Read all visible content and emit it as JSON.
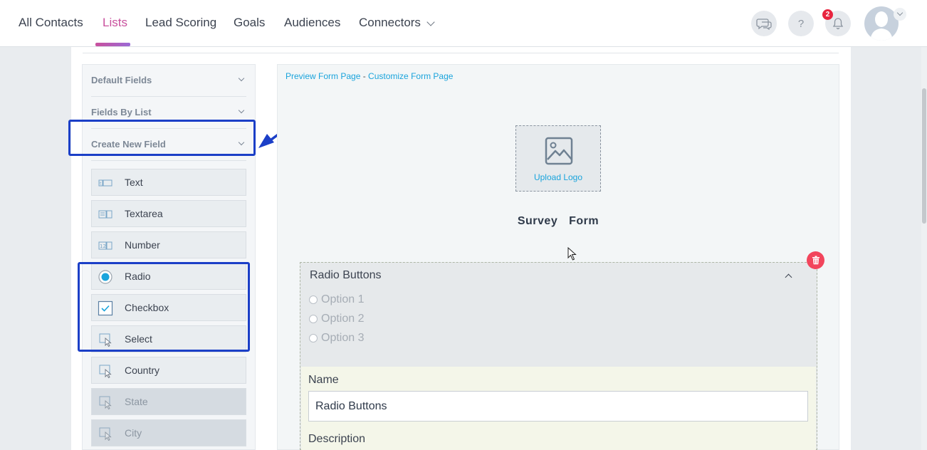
{
  "nav": {
    "items": [
      {
        "label": "All Contacts"
      },
      {
        "label": "Lists"
      },
      {
        "label": "Lead Scoring"
      },
      {
        "label": "Goals"
      },
      {
        "label": "Audiences"
      },
      {
        "label": "Connectors"
      }
    ],
    "active_item": "Lists",
    "notification_count": "2",
    "help_label": "?",
    "accent_color": "#c9509d"
  },
  "sidebar": {
    "sections": [
      {
        "label": "Default Fields",
        "icon": "chevron-down-icon"
      },
      {
        "label": "Fields By List",
        "icon": "chevron-down-icon"
      },
      {
        "label": "Create New Field",
        "icon": "chevron-down-icon"
      }
    ],
    "field_types": [
      {
        "label": "Text",
        "icon": "text-field-icon",
        "enabled": true
      },
      {
        "label": "Textarea",
        "icon": "textarea-field-icon",
        "enabled": true
      },
      {
        "label": "Number",
        "icon": "number-field-icon",
        "enabled": true
      },
      {
        "label": "Radio",
        "icon": "radio-field-icon",
        "enabled": true
      },
      {
        "label": "Checkbox",
        "icon": "checkbox-field-icon",
        "enabled": true
      },
      {
        "label": "Select",
        "icon": "select-field-icon",
        "enabled": true
      },
      {
        "label": "Country",
        "icon": "select-field-icon",
        "enabled": true
      },
      {
        "label": "State",
        "icon": "select-field-icon",
        "enabled": false
      },
      {
        "label": "City",
        "icon": "select-field-icon",
        "enabled": false
      }
    ]
  },
  "form": {
    "preview_link": "Preview Form Page",
    "separator": " - ",
    "customize_link": "Customize Form Page",
    "upload_logo": "Upload Logo",
    "title": "Survey  Form",
    "field": {
      "title": "Radio Buttons",
      "options": [
        "Option 1",
        "Option 2",
        "Option 3"
      ],
      "name_label": "Name",
      "name_value": "Radio Buttons",
      "description_label": "Description"
    }
  },
  "colors": {
    "link": "#1aa4dc",
    "highlight": "#1b3fc7",
    "delete": "#f2455c"
  }
}
